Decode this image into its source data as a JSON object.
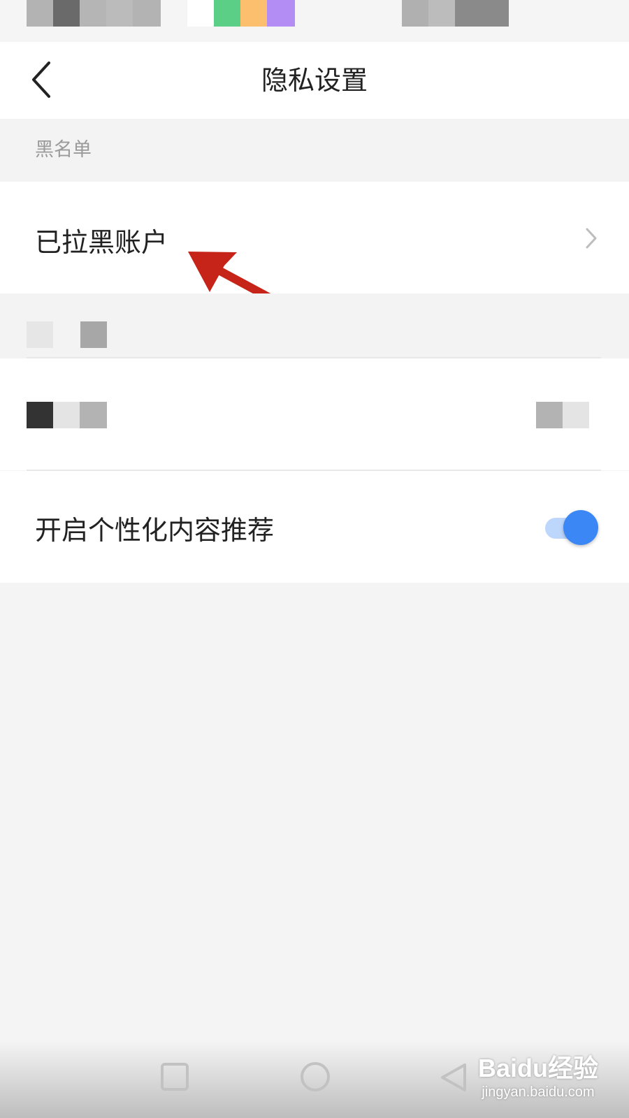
{
  "header": {
    "title": "隐私设置",
    "back_icon": "chevron-left-icon"
  },
  "blacklist_section": {
    "label": "黑名单"
  },
  "blocked_accounts_row": {
    "label": "已拉黑账户",
    "chevron_icon": "chevron-right-icon"
  },
  "annotation": {
    "arrow_icon": "red-arrow-icon",
    "color": "#c62418"
  },
  "personalization_row": {
    "label": "开启个性化内容推荐",
    "toggle_on": true
  },
  "colors": {
    "accent": "#3a87f5",
    "toggle_track": "#bdd6fb",
    "page_bg": "#f4f4f4",
    "row_bg": "#ffffff"
  },
  "navigation": {
    "recent_icon": "square-icon",
    "home_icon": "circle-icon",
    "back_icon": "triangle-back-icon"
  },
  "watermark": {
    "logo": "Baidu经验",
    "url": "jingyan.baidu.com"
  }
}
